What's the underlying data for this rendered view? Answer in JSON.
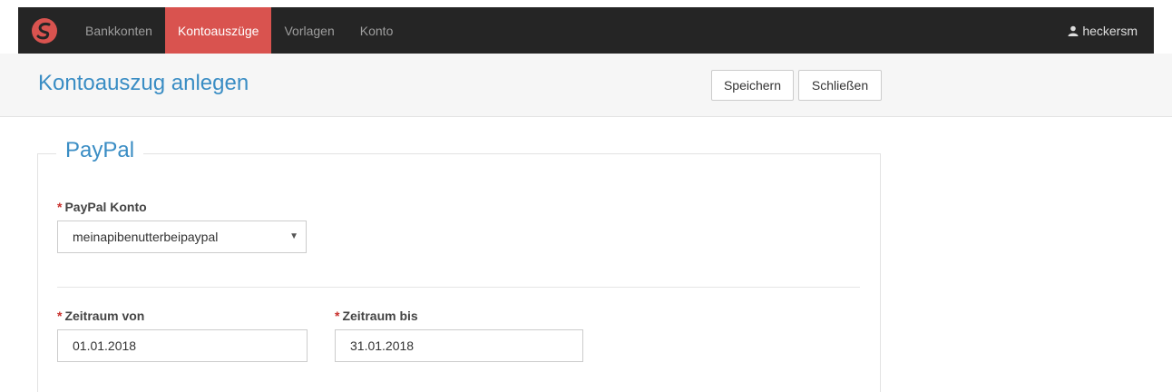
{
  "nav": {
    "items": [
      {
        "label": "Bankkonten",
        "active": false
      },
      {
        "label": "Kontoauszüge",
        "active": true
      },
      {
        "label": "Vorlagen",
        "active": false
      },
      {
        "label": "Konto",
        "active": false
      }
    ],
    "user": "heckersm"
  },
  "header": {
    "title": "Kontoauszug anlegen",
    "save_label": "Speichern",
    "close_label": "Schließen"
  },
  "form": {
    "legend": "PayPal",
    "paypal_account": {
      "label": "PayPal Konto",
      "value": "meinapibenutterbeipaypal"
    },
    "date_from": {
      "label": "Zeitraum von",
      "value": "01.01.2018"
    },
    "date_to": {
      "label": "Zeitraum bis",
      "value": "31.01.2018"
    },
    "required_marker": "*"
  },
  "colors": {
    "navbar": "#252525",
    "active_tab": "#d9534f",
    "accent": "#3a8dc4",
    "required": "#c9302c"
  },
  "icons": {
    "logo": "app-logo-icon",
    "user": "user-icon",
    "select": "caret-down-icon"
  }
}
